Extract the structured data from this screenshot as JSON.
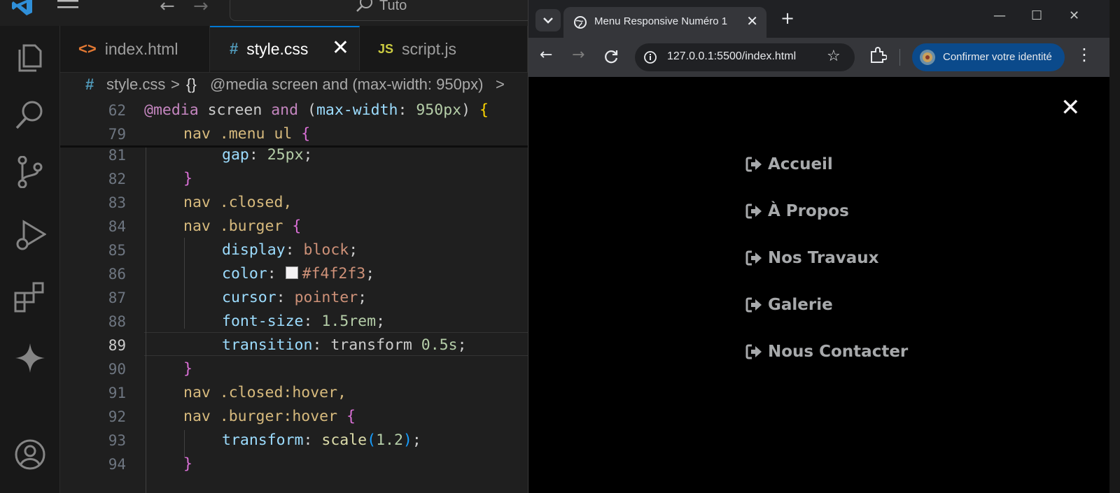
{
  "vscode": {
    "command_center": "Tuto",
    "tabs": [
      {
        "icon": "<>",
        "label": "index.html"
      },
      {
        "icon": "#",
        "label": "style.css",
        "close": "✕"
      },
      {
        "icon": "JS",
        "label": "script.js"
      }
    ],
    "breadcrumb": {
      "hash": "#",
      "file": "style.css",
      "sep1": ">",
      "braces": "{}",
      "scope": "@media screen and (max-width: 950px)",
      "sep2": ">"
    },
    "line_numbers": [
      "62",
      "79",
      "81",
      "82",
      "83",
      "84",
      "85",
      "86",
      "87",
      "88",
      "89",
      "90",
      "91",
      "92",
      "93",
      "94"
    ],
    "current_line": "89",
    "code": {
      "l62_at": "@media",
      "l62_rest": " screen ",
      "l62_and": "and",
      "l62_open": " (",
      "l62_prop": "max-width",
      "l62_colon": ": ",
      "l62_num": "950px",
      "l62_close": ") ",
      "l62_brace": "{",
      "l79_sel": "nav .menu ul ",
      "l79_brace": "{",
      "l81_prop": "gap",
      "l81_val": "25px",
      "l82_brace": "}",
      "l83_sel": "nav .closed,",
      "l84_sel": "nav .burger ",
      "l84_brace": "{",
      "l85_prop": "display",
      "l85_val": "block",
      "l86_prop": "color",
      "l86_val": "#f4f2f3",
      "l87_prop": "cursor",
      "l87_val": "pointer",
      "l88_prop": "font-size",
      "l88_val": "1.5rem",
      "l89_prop": "transition",
      "l89_val": "transform ",
      "l89_num": "0.5s",
      "l90_brace": "}",
      "l91_sel": "nav .closed:hover,",
      "l92_sel": "nav .burger:hover ",
      "l92_brace": "{",
      "l93_prop": "transform",
      "l93_fn": "scale",
      "l93_open": "(",
      "l93_num": "1.2",
      "l93_close": ")",
      "l94_brace": "}",
      "semicolon": ";",
      "colon": ": "
    }
  },
  "browser": {
    "tab_title": "Menu Responsive Numéro 1",
    "tab_close": "✕",
    "new_tab": "+",
    "window_controls": {
      "minimize": "—",
      "maximize": "☐",
      "close": "✕"
    },
    "url": "127.0.0.1:5500/index.html",
    "profile_button": "Confirmer votre identité",
    "page": {
      "close_icon": "✕",
      "menu_items": [
        "Accueil",
        "À Propos",
        "Nos Travaux",
        "Galerie",
        "Nous Contacter"
      ],
      "text_color": "#a7a9ab"
    }
  },
  "colors": {
    "accent": "#0078d4",
    "editor_bg": "#1f1f1f",
    "profile_blue": "#0b4a8b"
  }
}
